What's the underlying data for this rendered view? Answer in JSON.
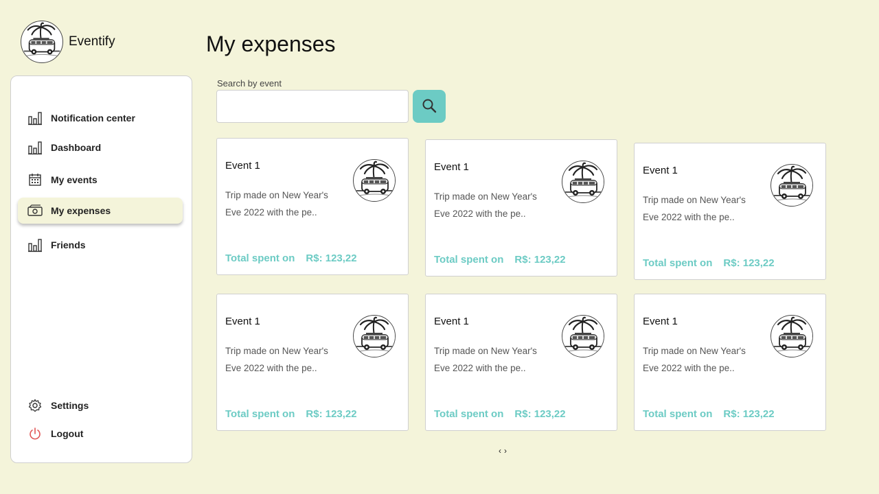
{
  "app": {
    "name": "Eventify",
    "logo_icon": "van-palm-logo-icon"
  },
  "sidebar": {
    "items": [
      {
        "label": "Notification center",
        "icon": "bar-chart-icon"
      },
      {
        "label": "Dashboard",
        "icon": "bar-chart-icon"
      },
      {
        "label": "My events",
        "icon": "calendar-icon"
      },
      {
        "label": "My expenses",
        "icon": "money-icon",
        "active": true
      },
      {
        "label": "Friends",
        "icon": "bar-chart-icon"
      }
    ],
    "bottom": [
      {
        "label": "Settings",
        "icon": "gear-icon"
      },
      {
        "label": "Logout",
        "icon": "power-icon"
      }
    ]
  },
  "page": {
    "title": "My expenses"
  },
  "search": {
    "label": "Search by event",
    "value": "",
    "placeholder": ""
  },
  "cards": [
    {
      "title": "Event 1",
      "description": "Trip made on New Year's Eve 2022 with the pe..",
      "total_label": "Total spent on",
      "total_value": "R$: 123,22"
    },
    {
      "title": "Event 1",
      "description": "Trip made on New Year's Eve 2022 with the pe..",
      "total_label": "Total spent on",
      "total_value": "R$: 123,22"
    },
    {
      "title": "Event 1",
      "description": "Trip made on New Year's Eve 2022 with the pe..",
      "total_label": "Total spent on",
      "total_value": "R$: 123,22"
    },
    {
      "title": "Event 1",
      "description": "Trip made on New Year's Eve 2022 with the pe..",
      "total_label": "Total spent on",
      "total_value": "R$: 123,22"
    },
    {
      "title": "Event 1",
      "description": "Trip made on New Year's Eve 2022 with the pe..",
      "total_label": "Total spent on",
      "total_value": "R$: 123,22"
    },
    {
      "title": "Event 1",
      "description": "Trip made on New Year's Eve 2022 with the pe..",
      "total_label": "Total spent on",
      "total_value": "R$: 123,22"
    }
  ],
  "pager": {
    "prev": "‹",
    "next": "›"
  },
  "colors": {
    "background": "#f4f4da",
    "accent": "#6ccbc4",
    "logout": "#e05555"
  }
}
